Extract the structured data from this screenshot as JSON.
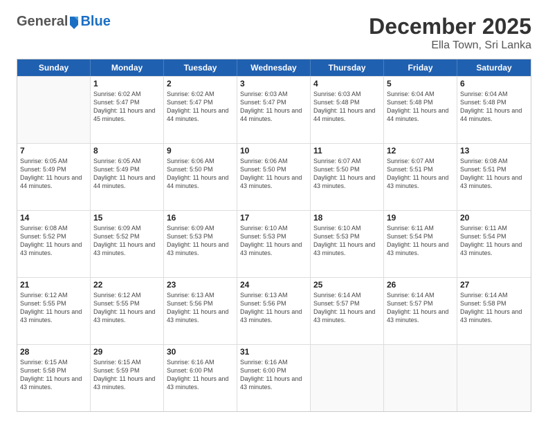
{
  "logo": {
    "general": "General",
    "blue": "Blue"
  },
  "title": "December 2025",
  "subtitle": "Ella Town, Sri Lanka",
  "days_of_week": [
    "Sunday",
    "Monday",
    "Tuesday",
    "Wednesday",
    "Thursday",
    "Friday",
    "Saturday"
  ],
  "weeks": [
    [
      {
        "day": "",
        "sunrise": "",
        "sunset": "",
        "daylight": ""
      },
      {
        "day": "1",
        "sunrise": "Sunrise: 6:02 AM",
        "sunset": "Sunset: 5:47 PM",
        "daylight": "Daylight: 11 hours and 45 minutes."
      },
      {
        "day": "2",
        "sunrise": "Sunrise: 6:02 AM",
        "sunset": "Sunset: 5:47 PM",
        "daylight": "Daylight: 11 hours and 44 minutes."
      },
      {
        "day": "3",
        "sunrise": "Sunrise: 6:03 AM",
        "sunset": "Sunset: 5:47 PM",
        "daylight": "Daylight: 11 hours and 44 minutes."
      },
      {
        "day": "4",
        "sunrise": "Sunrise: 6:03 AM",
        "sunset": "Sunset: 5:48 PM",
        "daylight": "Daylight: 11 hours and 44 minutes."
      },
      {
        "day": "5",
        "sunrise": "Sunrise: 6:04 AM",
        "sunset": "Sunset: 5:48 PM",
        "daylight": "Daylight: 11 hours and 44 minutes."
      },
      {
        "day": "6",
        "sunrise": "Sunrise: 6:04 AM",
        "sunset": "Sunset: 5:48 PM",
        "daylight": "Daylight: 11 hours and 44 minutes."
      }
    ],
    [
      {
        "day": "7",
        "sunrise": "Sunrise: 6:05 AM",
        "sunset": "Sunset: 5:49 PM",
        "daylight": "Daylight: 11 hours and 44 minutes."
      },
      {
        "day": "8",
        "sunrise": "Sunrise: 6:05 AM",
        "sunset": "Sunset: 5:49 PM",
        "daylight": "Daylight: 11 hours and 44 minutes."
      },
      {
        "day": "9",
        "sunrise": "Sunrise: 6:06 AM",
        "sunset": "Sunset: 5:50 PM",
        "daylight": "Daylight: 11 hours and 44 minutes."
      },
      {
        "day": "10",
        "sunrise": "Sunrise: 6:06 AM",
        "sunset": "Sunset: 5:50 PM",
        "daylight": "Daylight: 11 hours and 43 minutes."
      },
      {
        "day": "11",
        "sunrise": "Sunrise: 6:07 AM",
        "sunset": "Sunset: 5:50 PM",
        "daylight": "Daylight: 11 hours and 43 minutes."
      },
      {
        "day": "12",
        "sunrise": "Sunrise: 6:07 AM",
        "sunset": "Sunset: 5:51 PM",
        "daylight": "Daylight: 11 hours and 43 minutes."
      },
      {
        "day": "13",
        "sunrise": "Sunrise: 6:08 AM",
        "sunset": "Sunset: 5:51 PM",
        "daylight": "Daylight: 11 hours and 43 minutes."
      }
    ],
    [
      {
        "day": "14",
        "sunrise": "Sunrise: 6:08 AM",
        "sunset": "Sunset: 5:52 PM",
        "daylight": "Daylight: 11 hours and 43 minutes."
      },
      {
        "day": "15",
        "sunrise": "Sunrise: 6:09 AM",
        "sunset": "Sunset: 5:52 PM",
        "daylight": "Daylight: 11 hours and 43 minutes."
      },
      {
        "day": "16",
        "sunrise": "Sunrise: 6:09 AM",
        "sunset": "Sunset: 5:53 PM",
        "daylight": "Daylight: 11 hours and 43 minutes."
      },
      {
        "day": "17",
        "sunrise": "Sunrise: 6:10 AM",
        "sunset": "Sunset: 5:53 PM",
        "daylight": "Daylight: 11 hours and 43 minutes."
      },
      {
        "day": "18",
        "sunrise": "Sunrise: 6:10 AM",
        "sunset": "Sunset: 5:53 PM",
        "daylight": "Daylight: 11 hours and 43 minutes."
      },
      {
        "day": "19",
        "sunrise": "Sunrise: 6:11 AM",
        "sunset": "Sunset: 5:54 PM",
        "daylight": "Daylight: 11 hours and 43 minutes."
      },
      {
        "day": "20",
        "sunrise": "Sunrise: 6:11 AM",
        "sunset": "Sunset: 5:54 PM",
        "daylight": "Daylight: 11 hours and 43 minutes."
      }
    ],
    [
      {
        "day": "21",
        "sunrise": "Sunrise: 6:12 AM",
        "sunset": "Sunset: 5:55 PM",
        "daylight": "Daylight: 11 hours and 43 minutes."
      },
      {
        "day": "22",
        "sunrise": "Sunrise: 6:12 AM",
        "sunset": "Sunset: 5:55 PM",
        "daylight": "Daylight: 11 hours and 43 minutes."
      },
      {
        "day": "23",
        "sunrise": "Sunrise: 6:13 AM",
        "sunset": "Sunset: 5:56 PM",
        "daylight": "Daylight: 11 hours and 43 minutes."
      },
      {
        "day": "24",
        "sunrise": "Sunrise: 6:13 AM",
        "sunset": "Sunset: 5:56 PM",
        "daylight": "Daylight: 11 hours and 43 minutes."
      },
      {
        "day": "25",
        "sunrise": "Sunrise: 6:14 AM",
        "sunset": "Sunset: 5:57 PM",
        "daylight": "Daylight: 11 hours and 43 minutes."
      },
      {
        "day": "26",
        "sunrise": "Sunrise: 6:14 AM",
        "sunset": "Sunset: 5:57 PM",
        "daylight": "Daylight: 11 hours and 43 minutes."
      },
      {
        "day": "27",
        "sunrise": "Sunrise: 6:14 AM",
        "sunset": "Sunset: 5:58 PM",
        "daylight": "Daylight: 11 hours and 43 minutes."
      }
    ],
    [
      {
        "day": "28",
        "sunrise": "Sunrise: 6:15 AM",
        "sunset": "Sunset: 5:58 PM",
        "daylight": "Daylight: 11 hours and 43 minutes."
      },
      {
        "day": "29",
        "sunrise": "Sunrise: 6:15 AM",
        "sunset": "Sunset: 5:59 PM",
        "daylight": "Daylight: 11 hours and 43 minutes."
      },
      {
        "day": "30",
        "sunrise": "Sunrise: 6:16 AM",
        "sunset": "Sunset: 6:00 PM",
        "daylight": "Daylight: 11 hours and 43 minutes."
      },
      {
        "day": "31",
        "sunrise": "Sunrise: 6:16 AM",
        "sunset": "Sunset: 6:00 PM",
        "daylight": "Daylight: 11 hours and 43 minutes."
      },
      {
        "day": "",
        "sunrise": "",
        "sunset": "",
        "daylight": ""
      },
      {
        "day": "",
        "sunrise": "",
        "sunset": "",
        "daylight": ""
      },
      {
        "day": "",
        "sunrise": "",
        "sunset": "",
        "daylight": ""
      }
    ]
  ]
}
